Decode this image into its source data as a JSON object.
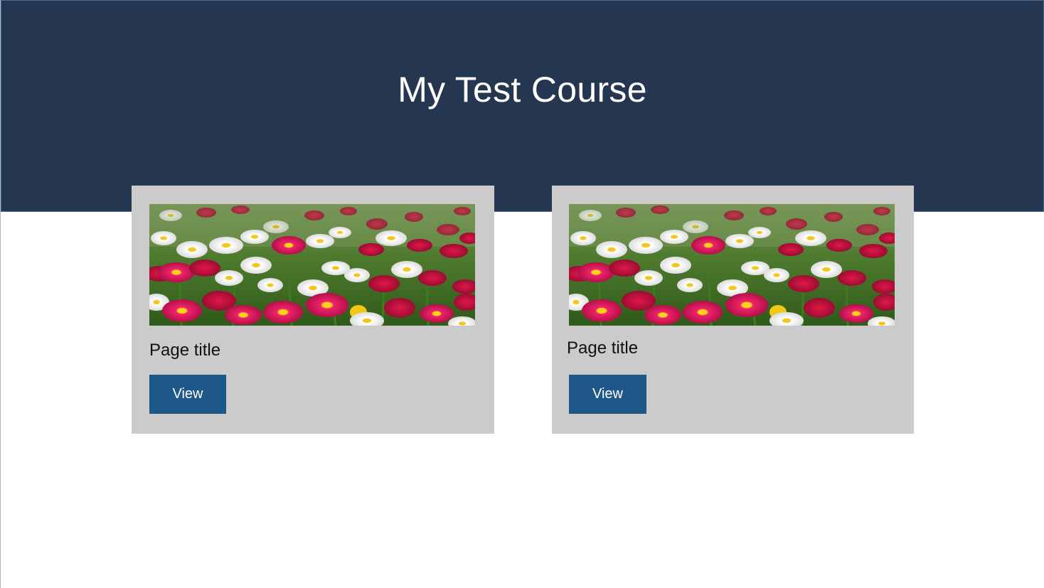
{
  "header": {
    "title": "My Test Course",
    "background_color": "#243650"
  },
  "cards": [
    {
      "image_name": "flower-field-image",
      "title": "Page title",
      "button_label": "View"
    },
    {
      "image_name": "flower-field-image",
      "title": "Page title",
      "button_label": "View"
    }
  ],
  "colors": {
    "card_background": "#cbcbcb",
    "button_background": "#1d5889",
    "button_text": "#ffffff"
  }
}
